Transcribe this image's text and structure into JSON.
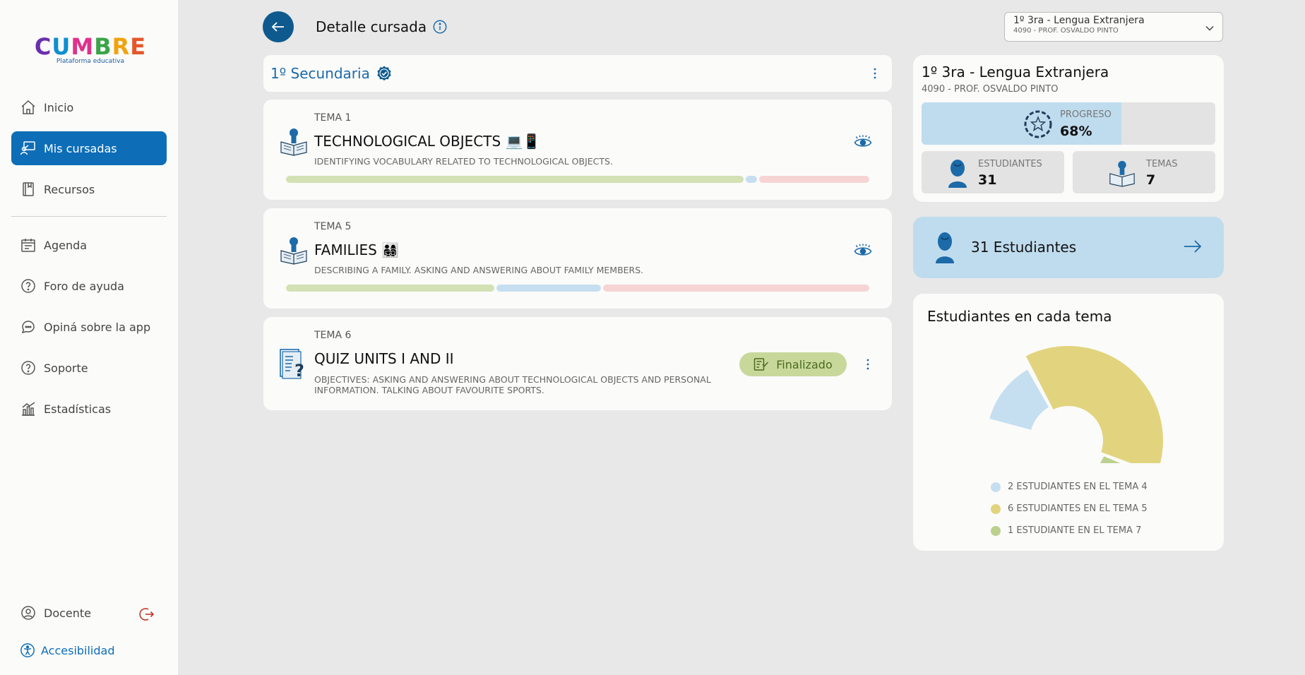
{
  "brand": {
    "logo_text": "CUMBRE",
    "logo_subtitle": "Plataforma educativa",
    "letter_colors": [
      "#6a2fb0",
      "#0d8fd0",
      "#e0318a",
      "#3ba348",
      "#f2a20d",
      "#e5572b"
    ]
  },
  "sidebar": {
    "items": [
      {
        "label": "Inicio",
        "icon": "home-icon"
      },
      {
        "label": "Mis cursadas",
        "icon": "classroom-icon"
      },
      {
        "label": "Recursos",
        "icon": "book-icon"
      },
      {
        "label": "Agenda",
        "icon": "calendar-icon"
      },
      {
        "label": "Foro de ayuda",
        "icon": "question-icon"
      },
      {
        "label": "Opiná sobre la app",
        "icon": "chat-icon"
      },
      {
        "label": "Soporte",
        "icon": "question-icon"
      },
      {
        "label": "Estadísticas",
        "icon": "stats-icon"
      }
    ],
    "user_label": "Docente",
    "accessibility_label": "Accesibilidad"
  },
  "header": {
    "title": "Detalle cursada",
    "course_selector": {
      "title": "1º 3ra - Lengua Extranjera",
      "subtitle": "4090 - PROF. OSVALDO PINTO"
    }
  },
  "level": {
    "title": "1º Secundaria"
  },
  "topics": [
    {
      "tema": "TEMA 1",
      "title": "TECHNOLOGICAL OBJECTS 💻📱",
      "description": "IDENTIFYING VOCABULARY RELATED TO TECHNOLOGICAL OBJECTS.",
      "progress": {
        "done": 0.79,
        "in_progress": 0.02,
        "pending": 0.19
      }
    },
    {
      "tema": "TEMA 5",
      "title": "FAMILIES 👨‍👩‍👧‍👦",
      "description": "DESCRIBING A FAMILY. ASKING AND ANSWERING ABOUT FAMILY MEMBERS.",
      "progress": {
        "done": 0.36,
        "in_progress": 0.18,
        "pending": 0.46
      }
    },
    {
      "tema": "TEMA 6",
      "title": "QUIZ UNITS I AND II",
      "description_l1": "OBJECTIVES: ASKING AND ANSWERING ABOUT TECHNOLOGICAL OBJECTS AND PERSONAL",
      "description_l2": "INFORMATION. TALKING ABOUT FAVOURITE SPORTS.",
      "badge": "Finalizado"
    }
  ],
  "summary": {
    "title": "1º 3ra - Lengua Extranjera",
    "subtitle": "4090 - PROF. OSVALDO PINTO",
    "progress_label": "PROGRESO",
    "progress_value": "68%",
    "progress_fraction": 0.68,
    "students_label": "ESTUDIANTES",
    "students_value": "31",
    "topics_label": "TEMAS",
    "topics_value": "7"
  },
  "students_link": {
    "label": "31 Estudiantes"
  },
  "chart_data": {
    "type": "pie",
    "title": "Estudiantes en cada tema",
    "slices": [
      {
        "label": "2 ESTUDIANTES EN EL TEMA 4",
        "value": 2,
        "color": "#c6dff0"
      },
      {
        "label": "6 ESTUDIANTES EN EL TEMA 5",
        "value": 6,
        "color": "#e2d47e"
      },
      {
        "label": "1 ESTUDIANTE EN EL TEMA 7",
        "value": 1,
        "color": "#bcd08e"
      }
    ]
  },
  "colors": {
    "accent": "#0d6db7",
    "progress_done": "#d3e1b4",
    "progress_in_progress": "#c6dff0",
    "progress_pending": "#f7d4d4"
  }
}
